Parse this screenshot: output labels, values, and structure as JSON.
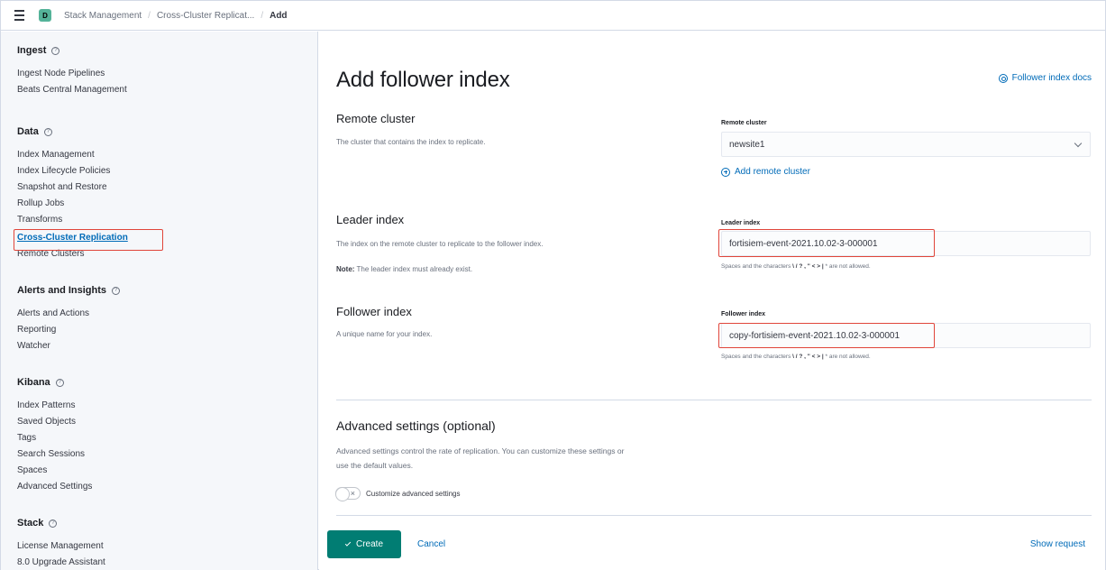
{
  "header": {
    "space_initial": "D",
    "breadcrumbs": [
      "Stack Management",
      "Cross-Cluster Replicat...",
      "Add"
    ]
  },
  "sidebar": {
    "groups": [
      {
        "title": "Ingest",
        "items": [
          "Ingest Node Pipelines",
          "Beats Central Management"
        ]
      },
      {
        "title": "Data",
        "items": [
          "Index Management",
          "Index Lifecycle Policies",
          "Snapshot and Restore",
          "Rollup Jobs",
          "Transforms",
          "Cross-Cluster Replication",
          "Remote Clusters"
        ]
      },
      {
        "title": "Alerts and Insights",
        "items": [
          "Alerts and Actions",
          "Reporting",
          "Watcher"
        ]
      },
      {
        "title": "Kibana",
        "items": [
          "Index Patterns",
          "Saved Objects",
          "Tags",
          "Search Sessions",
          "Spaces",
          "Advanced Settings"
        ]
      },
      {
        "title": "Stack",
        "items": [
          "License Management",
          "8.0 Upgrade Assistant"
        ]
      }
    ],
    "selected": "Cross-Cluster Replication"
  },
  "main": {
    "title": "Add follower index",
    "docs_link": "Follower index docs",
    "remote_cluster": {
      "section_title": "Remote cluster",
      "section_desc": "The cluster that contains the index to replicate.",
      "label": "Remote cluster",
      "value": "newsite1",
      "add_link": "Add remote cluster"
    },
    "leader_index": {
      "section_title": "Leader index",
      "section_desc": "The index on the remote cluster to replicate to the follower index.",
      "note_bold": "Note:",
      "note_text": " The leader index must already exist.",
      "label": "Leader index",
      "value": "fortisiem-event-2021.10.02-3-000001",
      "help_prefix": "Spaces and the characters ",
      "help_chars": "\\ / ? , \" < > |",
      "help_star": " * ",
      "help_suffix": "are not allowed."
    },
    "follower_index": {
      "section_title": "Follower index",
      "section_desc": "A unique name for your index.",
      "label": "Follower index",
      "value": "copy-fortisiem-event-2021.10.02-3-000001",
      "help_prefix": "Spaces and the characters ",
      "help_chars": "\\ / ? , \" < > |",
      "help_star": " * ",
      "help_suffix": "are not allowed."
    },
    "advanced": {
      "title": "Advanced settings (optional)",
      "desc_line1": "Advanced settings control the rate of replication. You can customize these settings or",
      "desc_line2": "use the default values.",
      "toggle_label": "Customize advanced settings",
      "toggle_on": false
    },
    "actions": {
      "create": "Create",
      "cancel": "Cancel",
      "show_request": "Show request"
    }
  },
  "colors": {
    "accent": "#006bb8",
    "primary_button": "#017d73",
    "highlight_box": "#e0453a"
  }
}
